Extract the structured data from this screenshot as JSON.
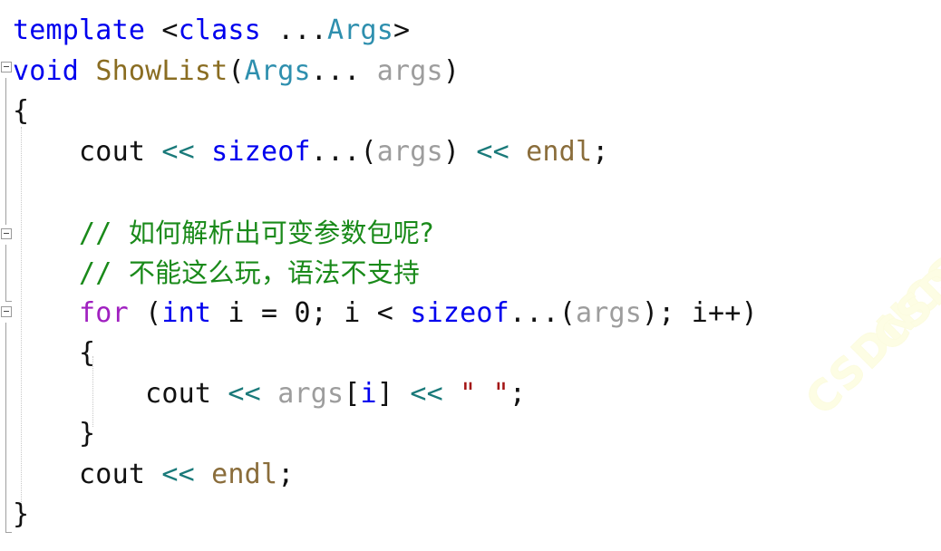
{
  "editor": {
    "language": "C++",
    "background": "#ffffff",
    "watermark": {
      "text": "CSDN",
      "repeated": "CSDNCSDN",
      "color": "#fdfde4"
    },
    "gutter": {
      "collapse_markers": [
        "collapse-minus-box",
        "collapse-minus-box",
        "collapse-minus-box"
      ],
      "marker_glyph": "-"
    },
    "colors": {
      "keyword": "#0000ee",
      "control_keyword": "#a020c0",
      "type": "#2e8fae",
      "function": "#8a6d22",
      "object": "#8a6d3b",
      "parameter": "#9d9d9d",
      "operator": "#1a7a7a",
      "plain": "#111111",
      "comment": "#1a8a1a",
      "string": "#a31515"
    },
    "lines": [
      {
        "id": "line-1",
        "text": "template <class ...Args>",
        "tokens": [
          {
            "t": "template",
            "c": "kw"
          },
          {
            "t": " ",
            "c": "plain"
          },
          {
            "t": "<",
            "c": "plain"
          },
          {
            "t": "class",
            "c": "kw"
          },
          {
            "t": " ...",
            "c": "plain"
          },
          {
            "t": "Args",
            "c": "type"
          },
          {
            "t": ">",
            "c": "plain"
          }
        ]
      },
      {
        "id": "line-2",
        "text": "void ShowList(Args... args)",
        "tokens": [
          {
            "t": "void",
            "c": "kw"
          },
          {
            "t": " ",
            "c": "plain"
          },
          {
            "t": "ShowList",
            "c": "fn"
          },
          {
            "t": "(",
            "c": "plain"
          },
          {
            "t": "Args",
            "c": "type"
          },
          {
            "t": "... ",
            "c": "plain"
          },
          {
            "t": "args",
            "c": "param"
          },
          {
            "t": ")",
            "c": "plain"
          }
        ]
      },
      {
        "id": "line-3",
        "text": "{",
        "tokens": [
          {
            "t": "{",
            "c": "plain"
          }
        ]
      },
      {
        "id": "line-4",
        "text": "    cout << sizeof...(args) << endl;",
        "tokens": [
          {
            "t": "    ",
            "c": "plain"
          },
          {
            "t": "cout",
            "c": "plain"
          },
          {
            "t": " ",
            "c": "plain"
          },
          {
            "t": "<<",
            "c": "op"
          },
          {
            "t": " ",
            "c": "plain"
          },
          {
            "t": "sizeof",
            "c": "kw"
          },
          {
            "t": "...(",
            "c": "plain"
          },
          {
            "t": "args",
            "c": "param"
          },
          {
            "t": ") ",
            "c": "plain"
          },
          {
            "t": "<<",
            "c": "op"
          },
          {
            "t": " ",
            "c": "plain"
          },
          {
            "t": "endl",
            "c": "obj"
          },
          {
            "t": ";",
            "c": "plain"
          }
        ]
      },
      {
        "id": "line-5",
        "text": "",
        "tokens": []
      },
      {
        "id": "line-6",
        "text": "    // 如何解析出可变参数包呢?",
        "tokens": [
          {
            "t": "    ",
            "c": "plain"
          },
          {
            "t": "// ",
            "c": "comment"
          },
          {
            "t": "如何解析出可变参数包呢?",
            "c": "comment-cjk"
          }
        ]
      },
      {
        "id": "line-7",
        "text": "    // 不能这么玩，语法不支持",
        "tokens": [
          {
            "t": "    ",
            "c": "plain"
          },
          {
            "t": "// ",
            "c": "comment"
          },
          {
            "t": "不能这么玩，语法不支持",
            "c": "comment-cjk"
          }
        ]
      },
      {
        "id": "line-8",
        "text": "    for (int i = 0; i < sizeof...(args); i++)",
        "tokens": [
          {
            "t": "    ",
            "c": "plain"
          },
          {
            "t": "for",
            "c": "ctrl"
          },
          {
            "t": " (",
            "c": "plain"
          },
          {
            "t": "int",
            "c": "kw"
          },
          {
            "t": " i = ",
            "c": "plain"
          },
          {
            "t": "0",
            "c": "num"
          },
          {
            "t": "; i < ",
            "c": "plain"
          },
          {
            "t": "sizeof",
            "c": "kw"
          },
          {
            "t": "...(",
            "c": "plain"
          },
          {
            "t": "args",
            "c": "param"
          },
          {
            "t": "); i++)",
            "c": "plain"
          }
        ]
      },
      {
        "id": "line-9",
        "text": "    {",
        "tokens": [
          {
            "t": "    {",
            "c": "plain"
          }
        ]
      },
      {
        "id": "line-10",
        "text": "        cout << args[i] << \" \";",
        "tokens": [
          {
            "t": "        ",
            "c": "plain"
          },
          {
            "t": "cout",
            "c": "plain"
          },
          {
            "t": " ",
            "c": "plain"
          },
          {
            "t": "<<",
            "c": "op"
          },
          {
            "t": " ",
            "c": "plain"
          },
          {
            "t": "args",
            "c": "param"
          },
          {
            "t": "[",
            "c": "plain"
          },
          {
            "t": "i",
            "c": "kw"
          },
          {
            "t": "] ",
            "c": "plain"
          },
          {
            "t": "<<",
            "c": "op"
          },
          {
            "t": " ",
            "c": "plain"
          },
          {
            "t": "\" \"",
            "c": "string"
          },
          {
            "t": ";",
            "c": "plain"
          }
        ]
      },
      {
        "id": "line-11",
        "text": "    }",
        "tokens": [
          {
            "t": "    }",
            "c": "plain"
          }
        ]
      },
      {
        "id": "line-12",
        "text": "    cout << endl;",
        "tokens": [
          {
            "t": "    ",
            "c": "plain"
          },
          {
            "t": "cout",
            "c": "plain"
          },
          {
            "t": " ",
            "c": "plain"
          },
          {
            "t": "<<",
            "c": "op"
          },
          {
            "t": " ",
            "c": "plain"
          },
          {
            "t": "endl",
            "c": "obj"
          },
          {
            "t": ";",
            "c": "plain"
          }
        ]
      },
      {
        "id": "line-13",
        "text": "}",
        "tokens": [
          {
            "t": "}",
            "c": "plain"
          }
        ]
      }
    ]
  }
}
